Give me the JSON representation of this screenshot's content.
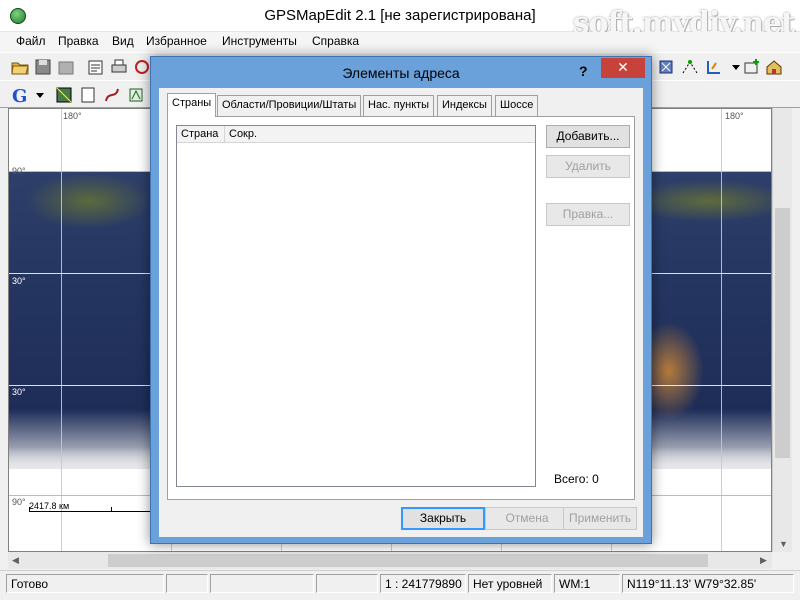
{
  "app": {
    "title": "GPSMapEdit 2.1 [не зарегистрирована]",
    "watermark": "soft.mydiv.net"
  },
  "menu": {
    "items": [
      "Файл",
      "Правка",
      "Вид",
      "Избранное",
      "Инструменты",
      "Справка"
    ]
  },
  "toolbar": {
    "icons": [
      "open-icon",
      "save-icon",
      "save-disabled-icon",
      "properties-icon",
      "print-icon",
      "tool-icon",
      "shield-icon",
      "dotted-line-icon",
      "waypoint-icon",
      "arrow-dropdown-icon",
      "add-layer-icon",
      "building-icon"
    ],
    "row2_icons": [
      "google-icon",
      "dropdown-arrow-icon",
      "image-icon",
      "blank-page-icon",
      "route-icon",
      "tracks-icon"
    ]
  },
  "map": {
    "lon_labels": [
      "180°",
      "180°"
    ],
    "lat_labels": [
      "90°",
      "30°",
      "30°",
      "90°"
    ],
    "scale_label": "2417.8 км",
    "colors": {
      "ocean": "#243560",
      "ice": "#dcdde2",
      "grid": "#ffffff"
    }
  },
  "dialog": {
    "title": "Элементы адреса",
    "help": "?",
    "close": "✕",
    "tabs": [
      "Страны",
      "Области/Провиции/Штаты",
      "Нас. пункты",
      "Индексы",
      "Шоссе"
    ],
    "active_tab": 0,
    "columns": [
      "Страна",
      "Сокр."
    ],
    "rows": [],
    "buttons": {
      "add": "Добавить...",
      "delete": "Удалить",
      "edit": "Правка..."
    },
    "total": "Всего: 0",
    "footer": {
      "close": "Закрыть",
      "cancel": "Отмена",
      "apply": "Применить"
    }
  },
  "status": {
    "ready": "Готово",
    "scale": "1 : 241779890",
    "levels": "Нет уровней",
    "wm": "WM:1",
    "coords": "N119°11.13' W79°32.85'"
  }
}
